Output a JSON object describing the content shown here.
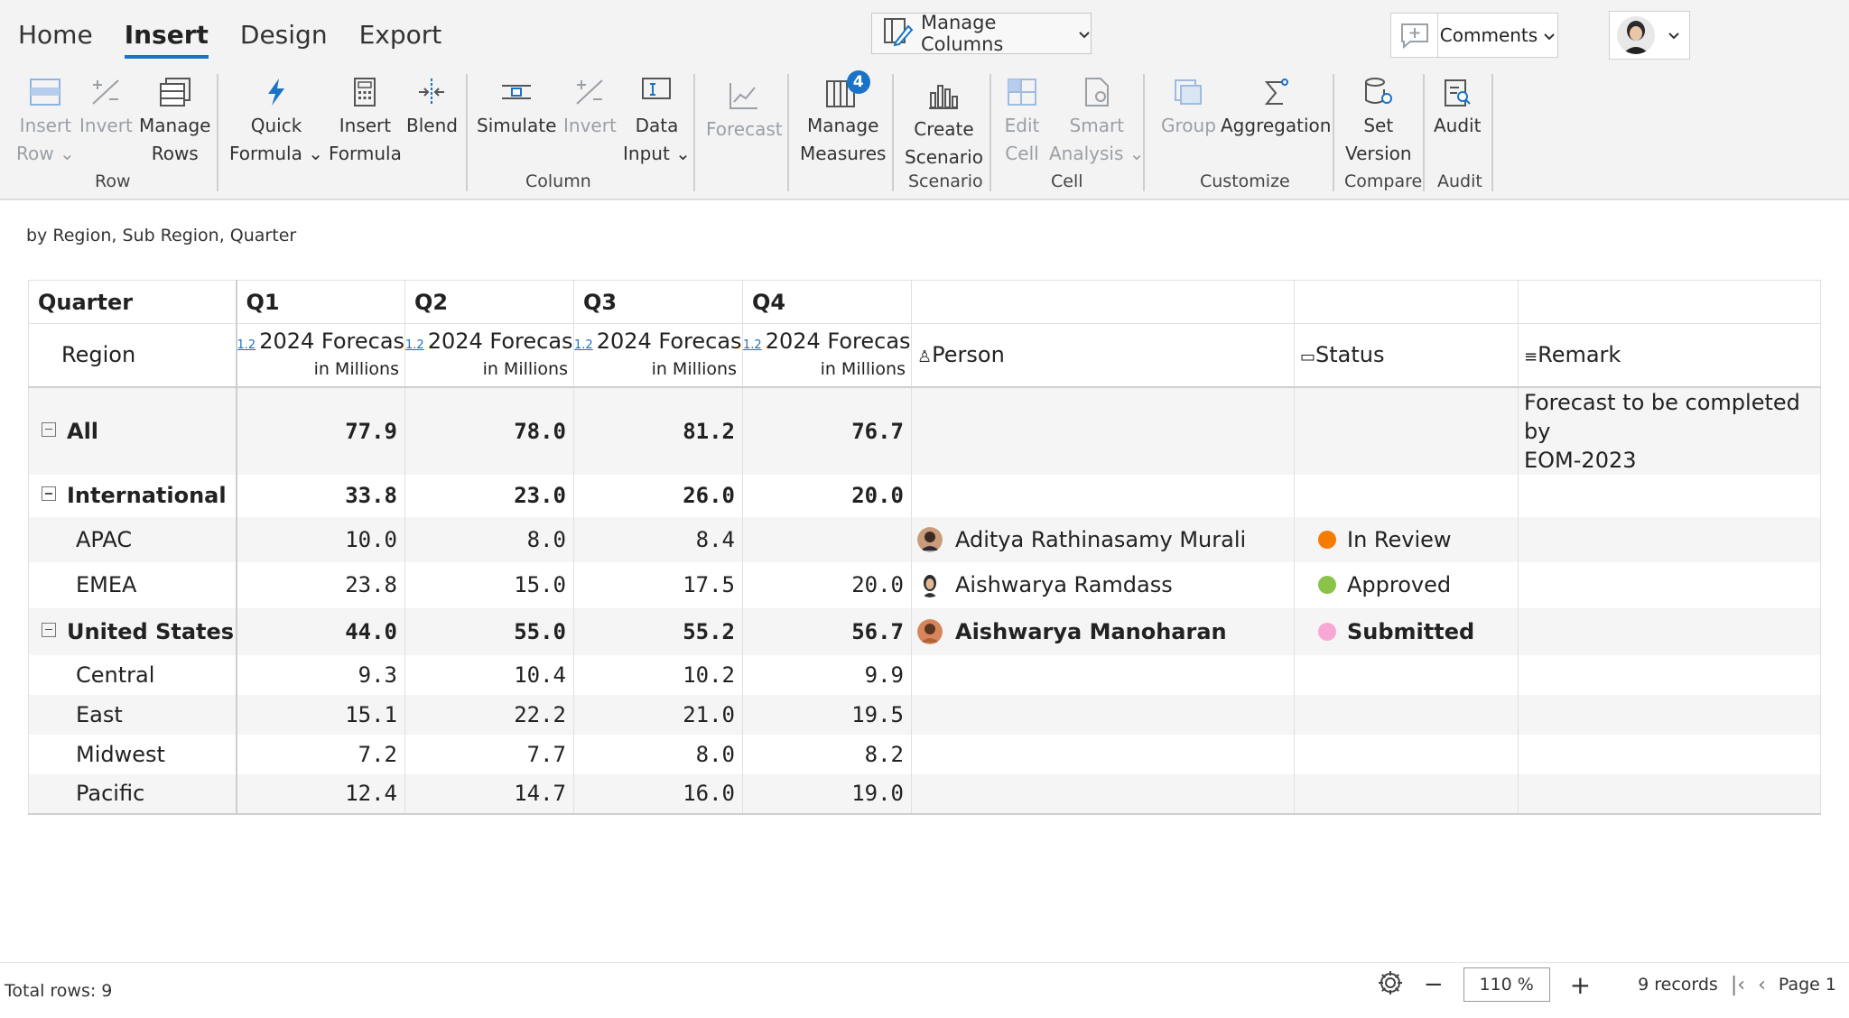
{
  "tabs": [
    {
      "label": "Home"
    },
    {
      "label": "Insert"
    },
    {
      "label": "Design"
    },
    {
      "label": "Export"
    }
  ],
  "header": {
    "manage_columns": "Manage Columns",
    "comments": "Comments"
  },
  "ribbon": {
    "tools": [
      {
        "line1": "Insert",
        "line2": "Row"
      },
      {
        "line1": "Invert",
        "line2": ""
      },
      {
        "line1": "Manage",
        "line2": "Rows"
      },
      {
        "line1": "Quick",
        "line2": "Formula"
      },
      {
        "line1": "Insert",
        "line2": "Formula"
      },
      {
        "line1": "Blend",
        "line2": ""
      },
      {
        "line1": "Simulate",
        "line2": ""
      },
      {
        "line1": "Invert",
        "line2": ""
      },
      {
        "line1": "Data",
        "line2": "Input"
      },
      {
        "line1": "Forecast",
        "line2": ""
      },
      {
        "line1": "Manage",
        "line2": "Measures",
        "badge": "4"
      },
      {
        "line1": "Create",
        "line2": "Scenario"
      },
      {
        "line1": "Edit",
        "line2": "Cell"
      },
      {
        "line1": "Smart",
        "line2": "Analysis"
      },
      {
        "line1": "Group",
        "line2": ""
      },
      {
        "line1": "Aggregation",
        "line2": ""
      },
      {
        "line1": "Set",
        "line2": "Version"
      },
      {
        "line1": "Audit",
        "line2": ""
      }
    ],
    "groups": [
      "Row",
      "Column",
      "Scenario",
      "Cell",
      "Customize",
      "Compare",
      "Audit"
    ]
  },
  "subtitle": "by Region, Sub Region, Quarter",
  "table": {
    "header1": {
      "first": "Quarter",
      "q": [
        "Q1",
        "Q2",
        "Q3",
        "Q4"
      ]
    },
    "header2": {
      "region": "Region",
      "measure_prefix": "1.2",
      "measure": "2024 Forecast",
      "unit": "in Millions",
      "person": "Person",
      "status": "Status",
      "remark": "Remark"
    },
    "rows": [
      {
        "label": "All",
        "vals": [
          "77.9",
          "78.0",
          "81.2",
          "76.7"
        ],
        "person": "",
        "status": "",
        "remark": "Forecast to be completed by",
        "remark2": "EOM-2023"
      },
      {
        "label": "International",
        "vals": [
          "33.8",
          "23.0",
          "26.0",
          "20.0"
        ],
        "person": "",
        "status": ""
      },
      {
        "label": "APAC",
        "vals": [
          "10.0",
          "8.0",
          "8.4",
          ""
        ],
        "person": "Aditya Rathinasamy Murali",
        "status": "In Review"
      },
      {
        "label": "EMEA",
        "vals": [
          "23.8",
          "15.0",
          "17.5",
          "20.0"
        ],
        "person": "Aishwarya Ramdass",
        "status": "Approved"
      },
      {
        "label": "United States",
        "vals": [
          "44.0",
          "55.0",
          "55.2",
          "56.7"
        ],
        "person": "Aishwarya Manoharan",
        "status": "Submitted"
      },
      {
        "label": "Central",
        "vals": [
          "9.3",
          "10.4",
          "10.2",
          "9.9"
        ],
        "person": "",
        "status": ""
      },
      {
        "label": "East",
        "vals": [
          "15.1",
          "22.2",
          "21.0",
          "19.5"
        ],
        "person": "",
        "status": ""
      },
      {
        "label": "Midwest",
        "vals": [
          "7.2",
          "7.7",
          "8.0",
          "8.2"
        ],
        "person": "",
        "status": ""
      },
      {
        "label": "Pacific",
        "vals": [
          "12.4",
          "14.7",
          "16.0",
          "19.0"
        ],
        "person": "",
        "status": ""
      }
    ]
  },
  "status_colors": {
    "in_review": "#f57c00",
    "approved": "#8bc34a",
    "submitted": "#f8a8d4"
  },
  "footer": {
    "total_rows": "Total rows: 9",
    "zoom_minus": "−",
    "zoom": "110 %",
    "zoom_plus": "+",
    "records": "9 records",
    "page": "Page 1"
  }
}
